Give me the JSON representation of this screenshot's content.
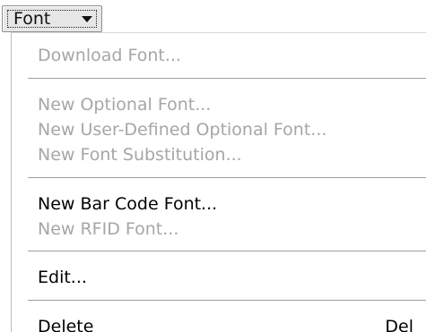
{
  "menu_button": {
    "label": "Font",
    "icon": "chevron-down-icon"
  },
  "menu": {
    "download_font": "Download Font...",
    "new_optional_font": "New Optional Font...",
    "new_user_defined_optional_font": "New User-Defined Optional Font...",
    "new_font_substitution": "New Font Substitution...",
    "new_bar_code_font": "New Bar Code Font...",
    "new_rfid_font": "New RFID Font...",
    "edit": "Edit...",
    "delete": "Delete",
    "delete_shortcut": "Del"
  },
  "colors": {
    "enabled_text": "#000000",
    "disabled_text": "#a6a6a6",
    "separator": "#9e9e9e"
  }
}
